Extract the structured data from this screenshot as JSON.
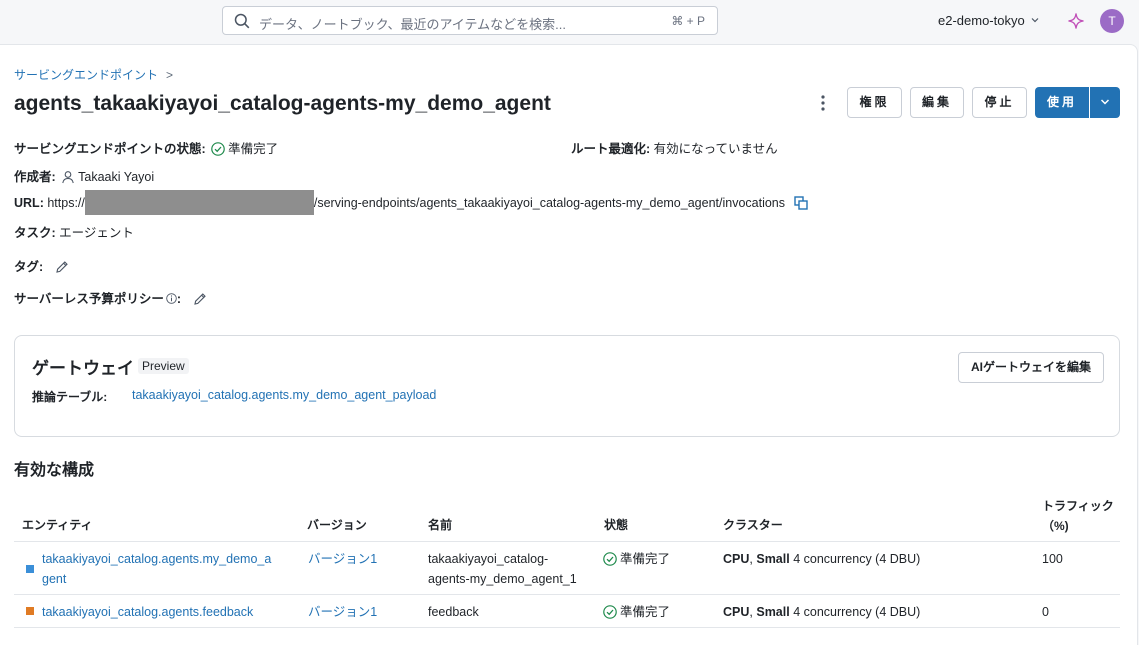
{
  "topbar": {
    "search_placeholder": "データ、ノートブック、最近のアイテムなどを検索...",
    "search_shortcut": "⌘ + P",
    "workspace": "e2-demo-tokyo",
    "avatar_initial": "T",
    "assistant_icon": "sparkle-icon"
  },
  "breadcrumb": {
    "label": "サービングエンドポイント",
    "separator": ">"
  },
  "title": "agents_takaakiyayoi_catalog-agents-my_demo_agent",
  "actions": {
    "permissions": "権限",
    "edit": "編集",
    "stop": "停止",
    "use": "使用"
  },
  "details": {
    "state_label": "サービングエンドポイントの状態:",
    "state_value": "準備完了",
    "route_label": "ルート最適化:",
    "route_value": "有効になっていません",
    "author_label": "作成者:",
    "author_value": "Takaaki Yayoi",
    "url_label": "URL:",
    "url_prefix": "https://",
    "url_suffix": "/serving-endpoints/agents_takaakiyayoi_catalog-agents-my_demo_agent/invocations",
    "task_label": "タスク:",
    "task_value": "エージェント",
    "tags_label": "タグ:",
    "budget_label": "サーバーレス予算ポリシー",
    "budget_colon": ":"
  },
  "gateway": {
    "title": "ゲートウェイ",
    "badge": "Preview",
    "inference_label": "推論テーブル:",
    "inference_value": "takaakiyayoi_catalog.agents.my_demo_agent_payload",
    "edit_button": "AIゲートウェイを編集"
  },
  "config": {
    "title": "有効な構成",
    "columns": [
      "エンティティ",
      "バージョン",
      "名前",
      "状態",
      "クラスター",
      "トラフィック（%)"
    ],
    "rows": [
      {
        "entity_line1": "takaakiyayoi_catalog.agents.my_demo_a",
        "entity_line2": "gent",
        "version": "バージョン1",
        "name_line1": "takaakiyayoi_catalog-",
        "name_line2": "agents-my_demo_agent_1",
        "status": "準備完了",
        "cluster_cpu": "CPU",
        "cluster_sep": ", ",
        "cluster_size": "Small",
        "cluster_rest": " 4 concurrency (4 DBU)",
        "traffic": "100",
        "color": "#3b8fd8"
      },
      {
        "entity_line1": "takaakiyayoi_catalog.agents.feedback",
        "entity_line2": "",
        "version": "バージョン1",
        "name_line1": "feedback",
        "name_line2": "",
        "status": "準備完了",
        "cluster_cpu": "CPU",
        "cluster_sep": ", ",
        "cluster_size": "Small",
        "cluster_rest": " 4 concurrency (4 DBU)",
        "traffic": "0",
        "color": "#e07b24"
      }
    ]
  }
}
